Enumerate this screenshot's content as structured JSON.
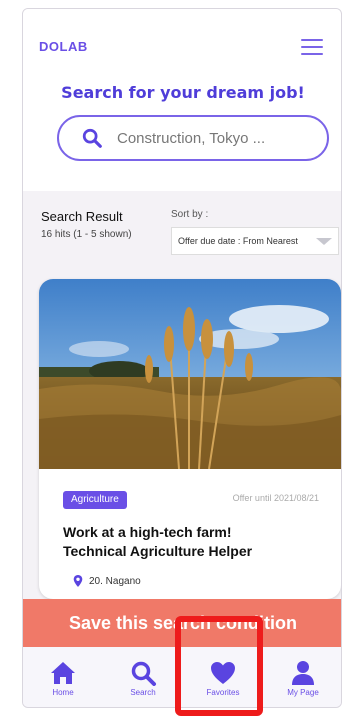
{
  "header": {
    "logo": "DOLAB",
    "tagline": "Search for your dream job!"
  },
  "search": {
    "placeholder": "Construction, Tokyo ..."
  },
  "results": {
    "title": "Search Result",
    "count": "16 hits (1 - 5 shown)",
    "sort_label": "Sort by :",
    "sort_value": "Offer due date : From Nearest"
  },
  "card": {
    "category": "Agriculture",
    "offer_until": "Offer until 2021/08/21",
    "title_line1": "Work at a high-tech farm!",
    "title_line2": "Technical Agriculture Helper",
    "location": "20. Nagano"
  },
  "save_button": "Save this search condition",
  "nav": {
    "items": [
      {
        "label": "Home",
        "icon": "home-icon"
      },
      {
        "label": "Search",
        "icon": "search-icon"
      },
      {
        "label": "Favorites",
        "icon": "heart-icon"
      },
      {
        "label": "My Page",
        "icon": "user-icon"
      }
    ]
  },
  "colors": {
    "accent": "#6a4fe6",
    "save": "#f07968",
    "highlight": "#ee1b1b"
  }
}
